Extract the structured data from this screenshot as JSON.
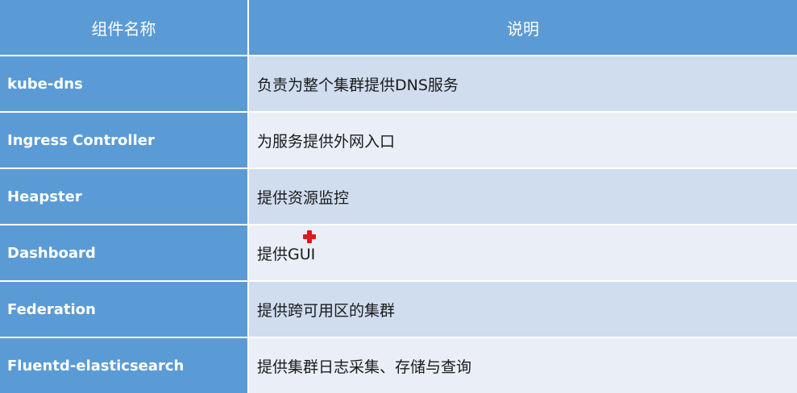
{
  "table": {
    "headers": [
      "组件名称",
      "说明"
    ],
    "rows": [
      {
        "name": "kube-dns",
        "desc": "负责为整个集群提供DNS服务"
      },
      {
        "name": "Ingress Controller",
        "desc": "为服务提供外网入口"
      },
      {
        "name": "Heapster",
        "desc": "提供资源监控"
      },
      {
        "name": "Dashboard",
        "desc": "提供GUI"
      },
      {
        "name": "Federation",
        "desc": "提供跨可用区的集群"
      },
      {
        "name": "Fluentd-elasticsearch",
        "desc": "提供集群日志采集、存储与查询"
      }
    ]
  },
  "colors": {
    "header_bg": "#5b9bd5",
    "row_odd_bg": "#d0ddef",
    "row_even_bg": "#e9eef7",
    "cursor_cross": "#e0181e"
  },
  "icons": {
    "cursor": "red-cross-cursor-icon"
  }
}
